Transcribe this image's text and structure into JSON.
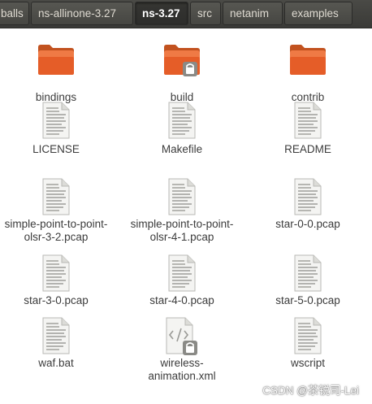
{
  "breadcrumb": {
    "items": [
      {
        "label": "balls",
        "active": false
      },
      {
        "label": "ns-allinone-3.27",
        "active": false
      },
      {
        "label": "ns-3.27",
        "active": true
      },
      {
        "label": "src",
        "active": false
      },
      {
        "label": "netanim",
        "active": false
      },
      {
        "label": "examples",
        "active": false
      }
    ]
  },
  "files": [
    {
      "name": "bindings",
      "icon": "folder-icon"
    },
    {
      "name": "build",
      "icon": "locked-folder-icon"
    },
    {
      "name": "contrib",
      "icon": "folder-icon"
    },
    {
      "name": "LICENSE",
      "icon": "text-file-icon"
    },
    {
      "name": "Makefile",
      "icon": "text-file-icon"
    },
    {
      "name": "README",
      "icon": "text-file-icon"
    },
    {
      "name": "simple-point-to-point-olsr-3-2.pcap",
      "icon": "text-file-icon"
    },
    {
      "name": "simple-point-to-point-olsr-4-1.pcap",
      "icon": "text-file-icon"
    },
    {
      "name": "star-0-0.pcap",
      "icon": "text-file-icon"
    },
    {
      "name": "star-3-0.pcap",
      "icon": "text-file-icon"
    },
    {
      "name": "star-4-0.pcap",
      "icon": "text-file-icon"
    },
    {
      "name": "star-5-0.pcap",
      "icon": "text-file-icon"
    },
    {
      "name": "waf.bat",
      "icon": "text-file-icon"
    },
    {
      "name": "wireless-animation.xml",
      "icon": "locked-xml-file-icon"
    },
    {
      "name": "wscript",
      "icon": "text-file-icon"
    }
  ],
  "watermark": "CSDN @茶锐司-Lei",
  "colors": {
    "pathbar": "#3c3b37",
    "folder": "#e9612d",
    "label": "#3c3c3c"
  }
}
